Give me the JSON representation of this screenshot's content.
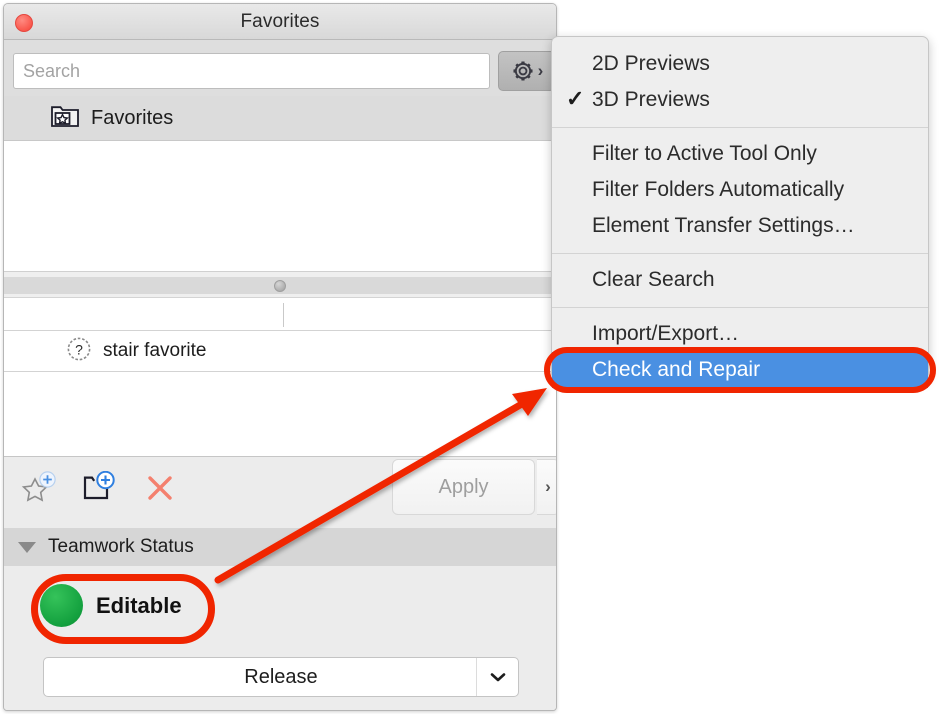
{
  "window": {
    "title": "Favorites",
    "close_button": "close-button"
  },
  "search": {
    "placeholder": "Search",
    "value": "",
    "settings_button_label": "gear"
  },
  "folder_row": {
    "label": "Favorites",
    "icon": "folder-star-icon"
  },
  "table": {
    "columns": [
      "",
      ""
    ],
    "rows": [
      {
        "icon": "question-mark-icon",
        "label": "stair favorite"
      }
    ]
  },
  "toolbar": {
    "new_favorite_label": "New Favorite",
    "new_folder_label": "New Folder",
    "delete_label": "Delete",
    "apply_label": "Apply",
    "apply_arrow_label": "›"
  },
  "teamwork": {
    "section_title": "Teamwork Status",
    "status_label": "Editable",
    "status_color": "#13a03e",
    "action_label": "Release",
    "action_chevron": "⌄"
  },
  "menu": {
    "groups": [
      {
        "items": [
          {
            "label": "2D Previews",
            "checked": false,
            "selected": false
          },
          {
            "label": "3D Previews",
            "checked": true,
            "selected": false
          }
        ]
      },
      {
        "items": [
          {
            "label": "Filter to Active Tool Only",
            "checked": false,
            "selected": false
          },
          {
            "label": "Filter Folders Automatically",
            "checked": false,
            "selected": false
          },
          {
            "label": "Element Transfer Settings…",
            "checked": false,
            "selected": false
          }
        ]
      },
      {
        "items": [
          {
            "label": "Clear Search",
            "checked": false,
            "selected": false
          }
        ]
      },
      {
        "items": [
          {
            "label": "Import/Export…",
            "checked": false,
            "selected": false
          },
          {
            "label": "Check and Repair",
            "checked": false,
            "selected": true
          }
        ]
      }
    ],
    "checkmark": "✓",
    "selected_bg": "#4a90e2",
    "highlight_color": "#f02500"
  },
  "annotations": {
    "highlight_color": "#f02500",
    "arrow_from": "Editable status",
    "arrow_to": "Check and Repair menu item"
  }
}
